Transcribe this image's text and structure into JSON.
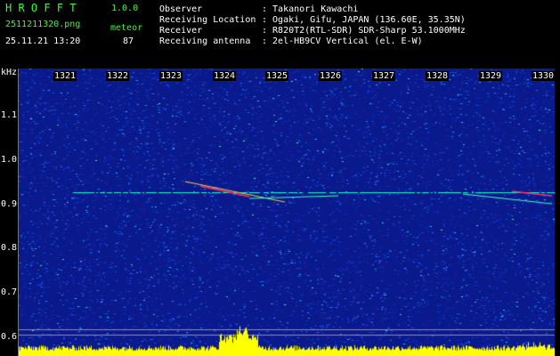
{
  "header": {
    "app_name": "H R O F F T",
    "version": "1.0.0",
    "filename": "2511211320.png",
    "datetime": "25.11.21 13:20",
    "mode_label": "meteor",
    "count": "87",
    "fields": [
      {
        "label": "Observer",
        "value": ": Takanori Kawachi"
      },
      {
        "label": "Receiving Location",
        "value": ": Ogaki, Gifu, JAPAN (136.60E, 35.35N)"
      },
      {
        "label": "Receiver",
        "value": ": R820T2(RTL-SDR) SDR-Sharp 53.1000MHz"
      },
      {
        "label": "Receiving antenna",
        "value": ": 2el-HB9CV Vertical (el. E-W)"
      }
    ]
  },
  "spectrogram": {
    "y_unit": "kHz",
    "x_ticks": [
      "1321",
      "1322",
      "1323",
      "1324",
      "1325",
      "1326",
      "1327",
      "1328",
      "1329",
      "1330"
    ],
    "y_ticks": [
      "1.1",
      "1.0",
      "0.9",
      "0.8",
      "0.7",
      "0.6"
    ],
    "colors": {
      "background": "#0a1a8c",
      "carrier": "#00ffcc",
      "echo": "#ff3366",
      "level_bar": "#ffff00"
    }
  }
}
